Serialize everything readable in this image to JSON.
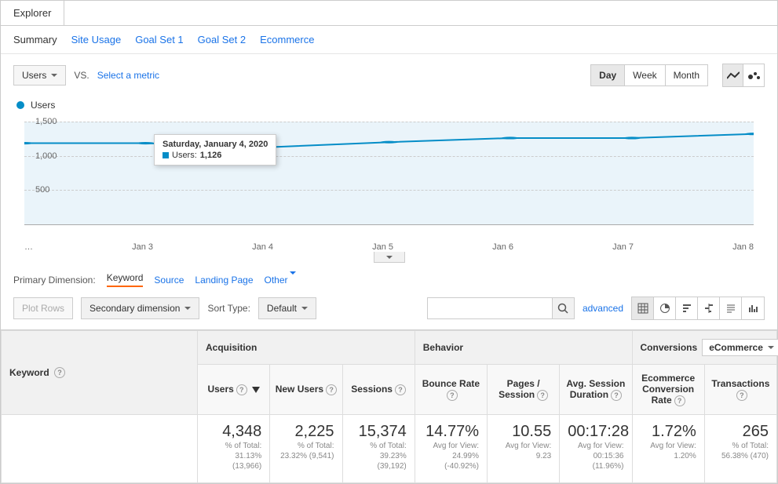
{
  "explorer": {
    "tab_label": "Explorer"
  },
  "subtabs": [
    "Summary",
    "Site Usage",
    "Goal Set 1",
    "Goal Set 2",
    "Ecommerce"
  ],
  "subtab_active_index": 0,
  "metric_selector": {
    "primary": "Users",
    "vs": "VS.",
    "select_prompt": "Select a metric"
  },
  "time_toggle": [
    "Day",
    "Week",
    "Month"
  ],
  "time_active_index": 0,
  "legend": {
    "label": "Users"
  },
  "chart_data": {
    "type": "line",
    "title": "Users",
    "ylabel": "",
    "xlabel": "",
    "ylim": [
      0,
      1500
    ],
    "y_ticks": [
      "1,500",
      "1,000",
      "500"
    ],
    "categories": [
      "…",
      "Jan 3",
      "Jan 4",
      "Jan 5",
      "Jan 6",
      "Jan 7",
      "Jan 8"
    ],
    "series": [
      {
        "name": "Users",
        "color": "#058dc7",
        "values": [
          1180,
          1185,
          1126,
          1195,
          1260,
          1255,
          1320
        ]
      }
    ],
    "tooltip": {
      "date": "Saturday, January 4, 2020",
      "metric": "Users:",
      "value": "1,126"
    }
  },
  "primary_dimension": {
    "label": "Primary Dimension:",
    "active": "Keyword",
    "others": [
      "Source",
      "Landing Page",
      "Other"
    ]
  },
  "filter_row": {
    "plot_rows": "Plot Rows",
    "secondary_dim": "Secondary dimension",
    "sort_type_label": "Sort Type:",
    "sort_type_value": "Default",
    "advanced": "advanced"
  },
  "table": {
    "keyword_header": "Keyword",
    "groups": [
      {
        "label": "Acquisition",
        "span": 3
      },
      {
        "label": "Behavior",
        "span": 3
      },
      {
        "label": "Conversions",
        "span": 2,
        "dropdown": "eCommerce"
      }
    ],
    "columns": [
      {
        "label": "Users",
        "sort": true
      },
      {
        "label": "New Users"
      },
      {
        "label": "Sessions"
      },
      {
        "label": "Bounce Rate"
      },
      {
        "label": "Pages / Session"
      },
      {
        "label": "Avg. Session Duration"
      },
      {
        "label": "Ecommerce Conversion Rate"
      },
      {
        "label": "Transactions"
      }
    ],
    "summary": [
      {
        "big": "4,348",
        "sub1": "% of Total:",
        "sub2": "31.13% (13,966)"
      },
      {
        "big": "2,225",
        "sub1": "% of Total:",
        "sub2": "23.32% (9,541)"
      },
      {
        "big": "15,374",
        "sub1": "% of Total:",
        "sub2": "39.23% (39,192)"
      },
      {
        "big": "14.77%",
        "sub1": "Avg for View:",
        "sub2": "24.99%",
        "sub3": "(-40.92%)"
      },
      {
        "big": "10.55",
        "sub1": "Avg for View:",
        "sub2": "9.23"
      },
      {
        "big": "00:17:28",
        "sub1": "Avg for View:",
        "sub2": "00:15:36",
        "sub3": "(11.96%)"
      },
      {
        "big": "1.72%",
        "sub1": "Avg for View:",
        "sub2": "1.20%"
      },
      {
        "big": "265",
        "sub1": "% of Total:",
        "sub2": "56.38% (470)"
      }
    ]
  }
}
